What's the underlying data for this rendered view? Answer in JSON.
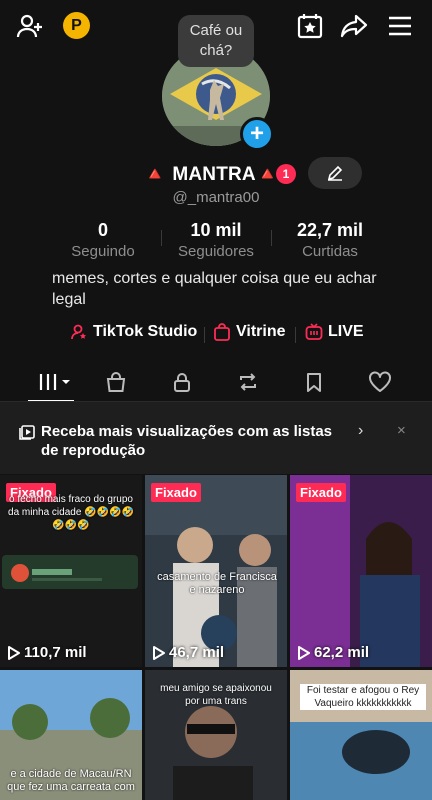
{
  "header": {
    "add_friend_icon": "person-plus-icon",
    "coin_label": "P",
    "tooltip_text": "Café ou chá?",
    "calendar_icon": "calendar-star-icon",
    "share_icon": "share-icon",
    "menu_icon": "hamburger-menu-icon"
  },
  "profile": {
    "display_name": "🔺 MANTRA🔺",
    "notification_count": "1",
    "handle": "@_mantra00",
    "bio": "memes, cortes e qualquer coisa que eu achar legal",
    "add_icon": "+"
  },
  "stats": [
    {
      "value": "0",
      "label": "Seguindo"
    },
    {
      "value": "10 mil",
      "label": "Seguidores"
    },
    {
      "value": "22,7 mil",
      "label": "Curtidas"
    }
  ],
  "links": {
    "studio": "TikTok Studio",
    "showcase": "Vitrine",
    "live": "LIVE"
  },
  "tabs": [
    "grid-icon",
    "shopping-bag-icon",
    "lock-icon",
    "repost-icon",
    "bookmark-icon",
    "heart-icon"
  ],
  "playlist_banner": {
    "text": "Receba mais visualizações com as listas de reprodução",
    "chevron": "›",
    "close": "×"
  },
  "videos": [
    {
      "pinned": "Fixado",
      "caption": "o fecho mais fraco do grupo da minha cidade 🤣🤣🤣🤣🤣🤣🤣",
      "views": "110,7 mil"
    },
    {
      "pinned": "Fixado",
      "caption": "casamento de Francisca e nazareno",
      "views": "46,7 mil"
    },
    {
      "pinned": "Fixado",
      "caption": "",
      "views": "62,2 mil"
    },
    {
      "pinned": "",
      "caption": "e a cidade de Macau/RN que fez uma carreata com",
      "views": ""
    },
    {
      "pinned": "",
      "caption": "meu amigo se apaixonou por uma trans",
      "views": ""
    },
    {
      "pinned": "",
      "caption": "Foi testar e afogou o Rey Vaqueiro kkkkkkkkkkk",
      "views": ""
    }
  ],
  "colors": {
    "accent": "#fe2c55",
    "background": "#121212",
    "link_blue": "#20a0e8",
    "coin": "#f4b400"
  }
}
